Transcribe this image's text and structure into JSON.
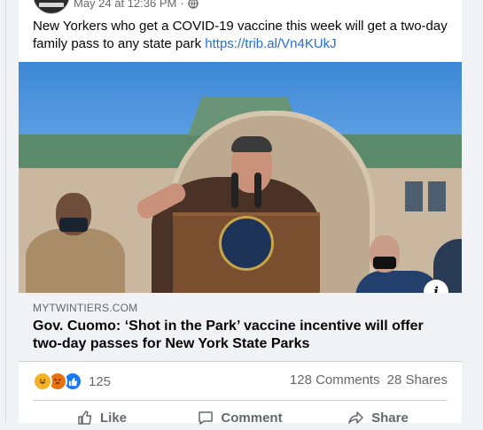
{
  "post": {
    "timestamp": "May 24 at 12:36 PM",
    "separator": "·",
    "text": "New Yorkers who get a COVID-19 vaccine this week will get a two-day family pass to any state park ",
    "link_text": "https://trib.al/Vn4KUkJ"
  },
  "link_preview": {
    "domain": "MYTWINTIERS.COM",
    "headline": "Gov. Cuomo: ‘Shot in the Park’ vaccine incentive will offer two-day passes for New York State Parks",
    "info_glyph": "i"
  },
  "engagement": {
    "reaction_icons": [
      "haha-reaction-icon",
      "angry-reaction-icon",
      "like-reaction-icon"
    ],
    "reaction_count": "125",
    "comments": "128 Comments",
    "shares": "28 Shares"
  },
  "actions": {
    "like": "Like",
    "comment": "Comment",
    "share": "Share"
  },
  "colors": {
    "link": "#216fdb",
    "secondary_text": "#65676b",
    "like_blue": "#1877f2"
  }
}
